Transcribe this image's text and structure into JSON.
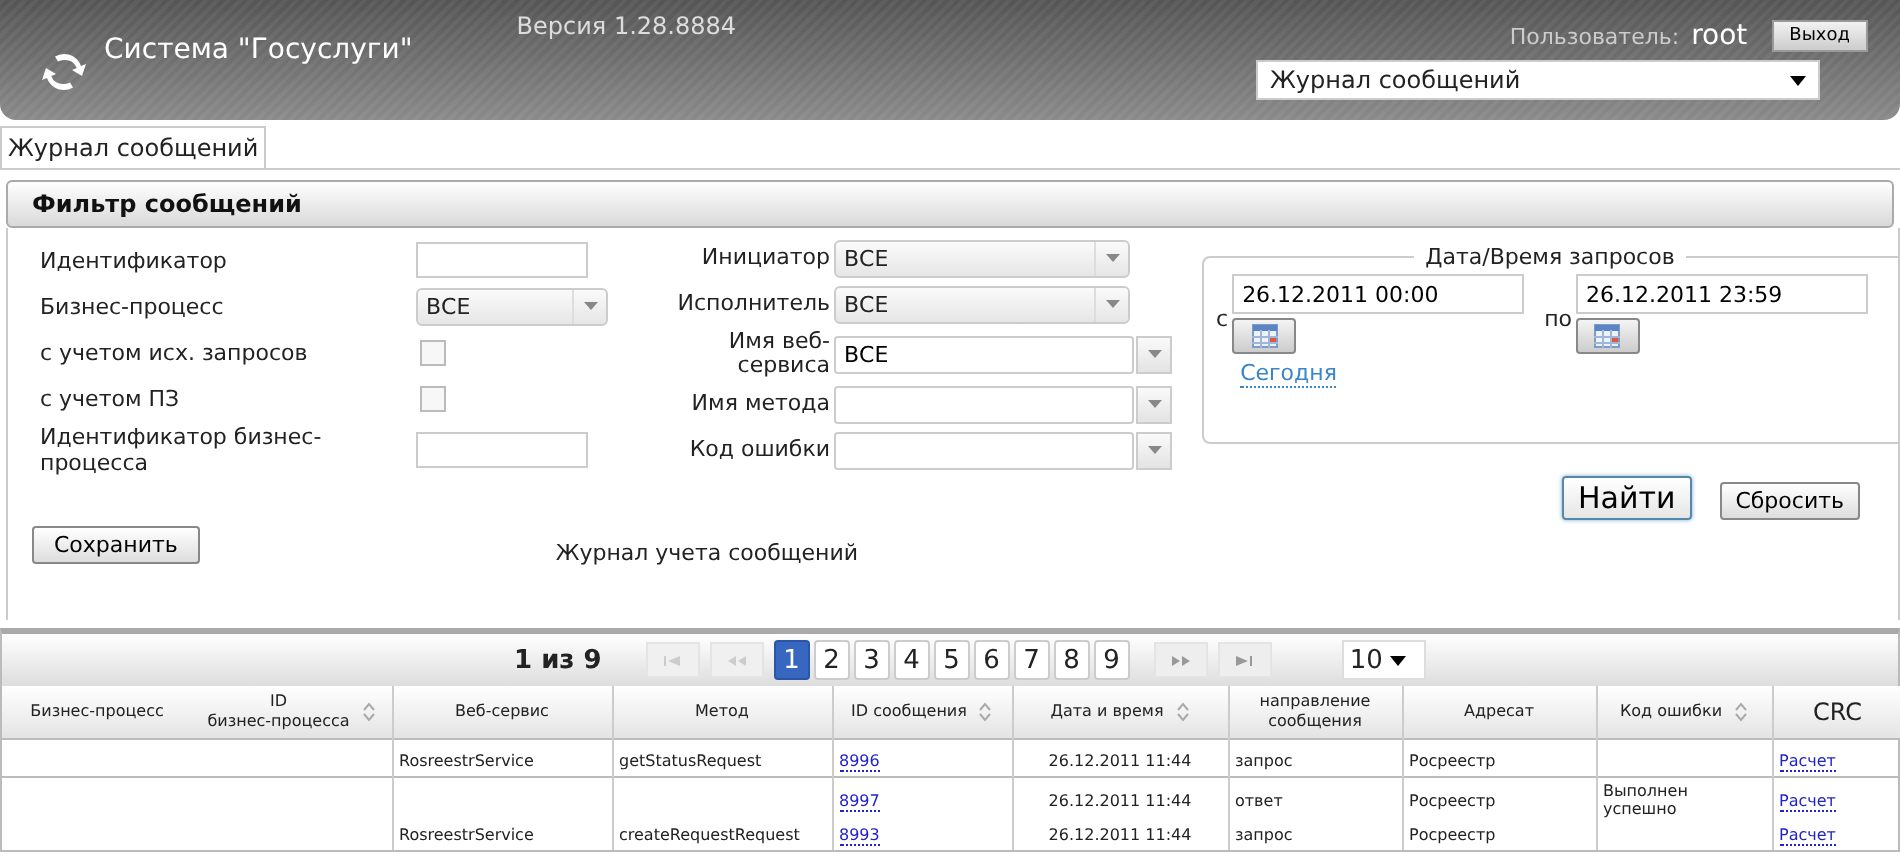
{
  "header": {
    "app_title": "Система \"Госуслуги\"",
    "version": "Версия 1.28.8884",
    "user_label": "Пользователь:",
    "user_name": "root",
    "logout_button": "Выход",
    "section_select": "Журнал сообщений"
  },
  "tabs": [
    {
      "label": "Журнал сообщений",
      "selected": true
    }
  ],
  "filter": {
    "title": "Фильтр сообщений",
    "left_fields": [
      {
        "kind": "text",
        "label": "Идентификатор"
      },
      {
        "kind": "select",
        "label": "Бизнес-процесс",
        "value": "ВСЕ"
      },
      {
        "kind": "checkbox",
        "label": "с учетом исх. запросов",
        "checked": false
      },
      {
        "kind": "checkbox",
        "label": "с учетом ПЗ",
        "checked": false
      },
      {
        "kind": "text",
        "label": "Идентификатор бизнес-процесса"
      }
    ],
    "middle_fields": [
      {
        "kind": "select",
        "label": "Инициатор",
        "value": "ВСЕ"
      },
      {
        "kind": "select",
        "label": "Исполнитель",
        "value": "ВСЕ"
      },
      {
        "kind": "combo",
        "label": "Имя веб-сервиса",
        "value": "ВСЕ"
      },
      {
        "kind": "combo",
        "label": "Имя метода"
      },
      {
        "kind": "combo",
        "label": "Код ошибки"
      }
    ],
    "date_range": {
      "legend": "Дата/Время запросов",
      "from_label": "с",
      "from_value": "26.12.2011 00:00",
      "to_label": "по",
      "to_value": "26.12.2011 23:59",
      "today_link": "Сегодня"
    },
    "find_button": "Найти",
    "reset_button": "Сбросить",
    "save_button": "Сохранить",
    "caption": "Журнал учета сообщений"
  },
  "pager": {
    "summary": "1 из 9",
    "pages": [
      {
        "label": "1",
        "selected": true
      },
      {
        "label": "2",
        "selected": false
      },
      {
        "label": "3",
        "selected": false
      },
      {
        "label": "4",
        "selected": false
      },
      {
        "label": "5",
        "selected": false
      },
      {
        "label": "6",
        "selected": false
      },
      {
        "label": "7",
        "selected": false
      },
      {
        "label": "8",
        "selected": false
      },
      {
        "label": "9",
        "selected": false
      }
    ],
    "first_disabled": true,
    "prev_disabled": true,
    "next_disabled": false,
    "last_disabled": false,
    "page_size": "10"
  },
  "table": {
    "columns": [
      {
        "label": "Бизнес-процесс",
        "sortable": false
      },
      {
        "label": "ID\nбизнес-процесса",
        "sortable": true
      },
      {
        "label": "Веб-сервис",
        "sortable": false
      },
      {
        "label": "Метод",
        "sortable": false
      },
      {
        "label": "ID сообщения",
        "sortable": true
      },
      {
        "label": "Дата и время",
        "sortable": true
      },
      {
        "label": "направление\nсообщения",
        "sortable": false
      },
      {
        "label": "Адресат",
        "sortable": false
      },
      {
        "label": "Код ошибки",
        "sortable": true
      },
      {
        "label": "CRC",
        "sortable": false
      }
    ],
    "groups": [
      {
        "rows": [
          [
            "",
            "",
            "RosreestrService",
            "getStatusRequest",
            "8996",
            "26.12.2011 11:44",
            "запрос",
            "Росреестр",
            "",
            "Расчет"
          ]
        ]
      },
      {
        "rows": [
          [
            "",
            "",
            "",
            "",
            "8997",
            "26.12.2011 11:44",
            "ответ",
            "Росреестр",
            "Выполнен успешно",
            "Расчет"
          ],
          [
            "",
            "",
            "RosreestrService",
            "createRequestRequest",
            "8993",
            "26.12.2011 11:44",
            "запрос",
            "Росреестр",
            "",
            "Расчет"
          ]
        ]
      }
    ]
  }
}
